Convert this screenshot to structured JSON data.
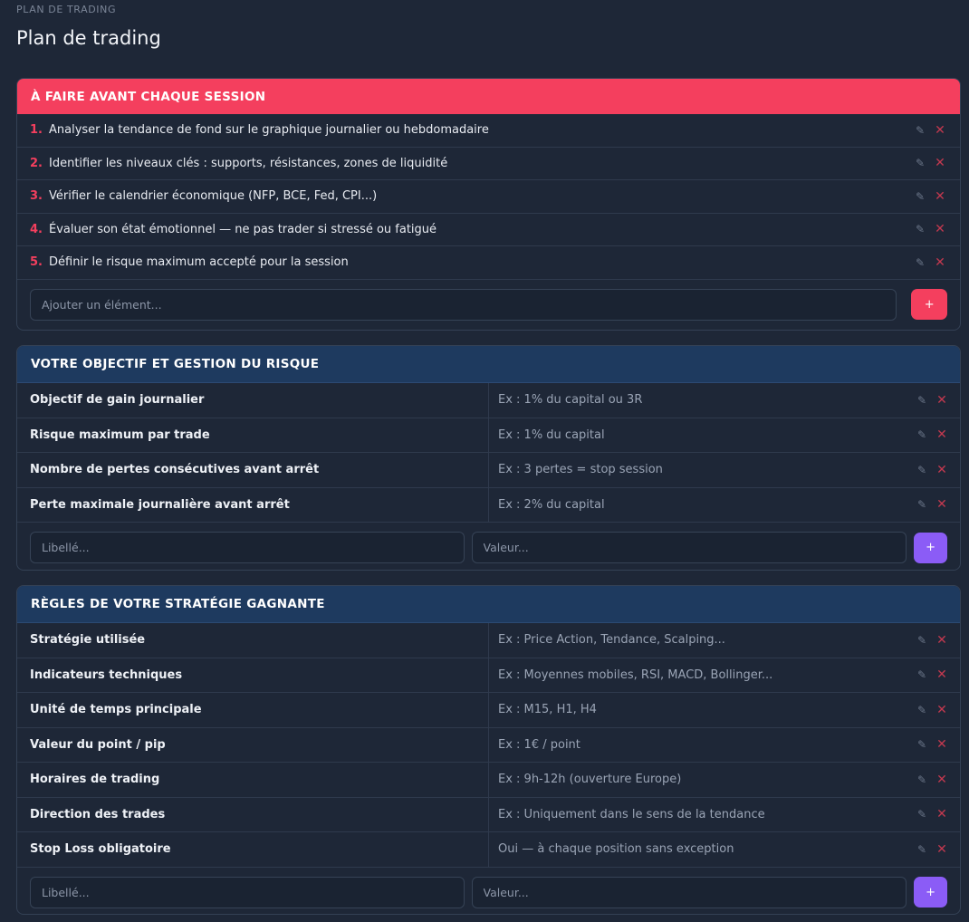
{
  "breadcrumb": "PLAN DE TRADING",
  "page_title": "Plan de trading",
  "icons": {
    "edit": "pencil-icon",
    "delete": "close-icon"
  },
  "colors": {
    "accent_red": "#f43f5e",
    "header_blue": "#1e3a5f",
    "add_purple": "#8b5cf6"
  },
  "checklist": {
    "title": "À FAIRE AVANT CHAQUE SESSION",
    "items": [
      {
        "num": "1.",
        "text": "Analyser la tendance de fond sur le graphique journalier ou hebdomadaire"
      },
      {
        "num": "2.",
        "text": "Identifier les niveaux clés : supports, résistances, zones de liquidité"
      },
      {
        "num": "3.",
        "text": "Vérifier le calendrier économique (NFP, BCE, Fed, CPI...)"
      },
      {
        "num": "4.",
        "text": "Évaluer son état émotionnel — ne pas trader si stressé ou fatigué"
      },
      {
        "num": "5.",
        "text": "Définir le risque maximum accepté pour la session"
      }
    ],
    "add_placeholder": "Ajouter un élément...",
    "add_button": "+"
  },
  "risk": {
    "title": "VOTRE OBJECTIF ET GESTION DU RISQUE",
    "rows": [
      {
        "label": "Objectif de gain journalier",
        "value": "Ex : 1% du capital ou 3R"
      },
      {
        "label": "Risque maximum par trade",
        "value": "Ex : 1% du capital"
      },
      {
        "label": "Nombre de pertes consécutives avant arrêt",
        "value": "Ex : 3 pertes = stop session"
      },
      {
        "label": "Perte maximale journalière avant arrêt",
        "value": "Ex : 2% du capital"
      }
    ],
    "label_placeholder": "Libellé...",
    "value_placeholder": "Valeur...",
    "add_button": "+"
  },
  "strategy": {
    "title": "RÈGLES DE VOTRE STRATÉGIE GAGNANTE",
    "rows": [
      {
        "label": "Stratégie utilisée",
        "value": "Ex : Price Action, Tendance, Scalping..."
      },
      {
        "label": "Indicateurs techniques",
        "value": "Ex : Moyennes mobiles, RSI, MACD, Bollinger..."
      },
      {
        "label": "Unité de temps principale",
        "value": "Ex : M15, H1, H4"
      },
      {
        "label": "Valeur du point / pip",
        "value": "Ex : 1€ / point"
      },
      {
        "label": "Horaires de trading",
        "value": "Ex : 9h-12h (ouverture Europe)"
      },
      {
        "label": "Direction des trades",
        "value": "Ex : Uniquement dans le sens de la tendance"
      },
      {
        "label": "Stop Loss obligatoire",
        "value": "Oui — à chaque position sans exception"
      }
    ],
    "label_placeholder": "Libellé...",
    "value_placeholder": "Valeur...",
    "add_button": "+"
  }
}
